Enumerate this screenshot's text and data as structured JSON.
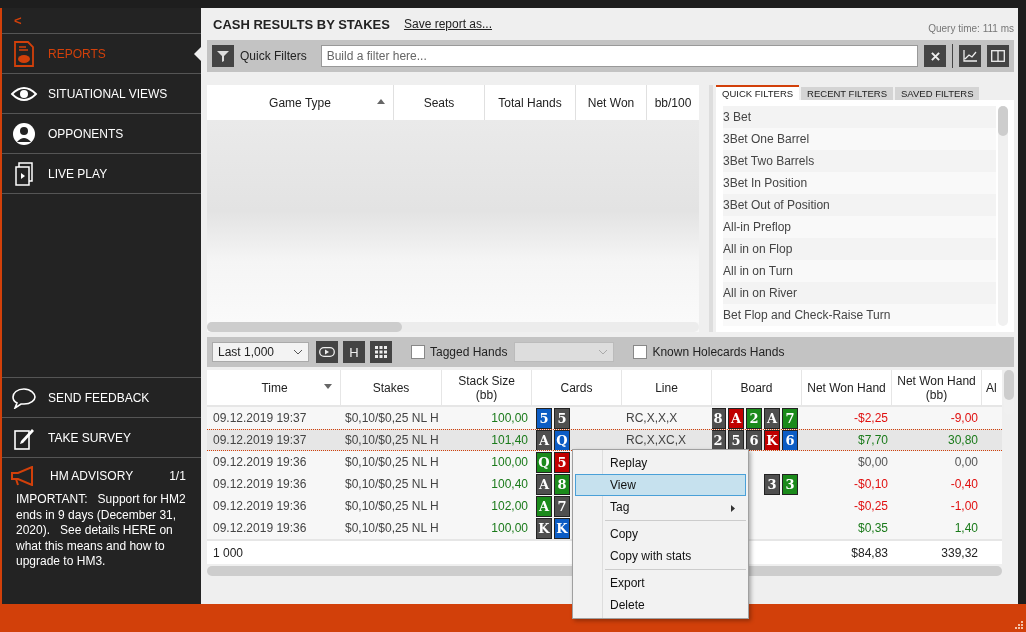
{
  "sidebar": {
    "collapse": "<",
    "items": [
      {
        "label": "REPORTS",
        "selected": true
      },
      {
        "label": "SITUATIONAL VIEWS",
        "selected": false
      },
      {
        "label": "OPPONENTS",
        "selected": false
      },
      {
        "label": "LIVE PLAY",
        "selected": false
      }
    ],
    "bottom_items": [
      {
        "label": "SEND FEEDBACK"
      },
      {
        "label": "TAKE SURVEY"
      }
    ],
    "advisory": {
      "title": "HM ADVISORY",
      "count": "1/1",
      "text": "IMPORTANT:   Support for HM2 ends in 9 days (December 31, 2020).   See details HERE on what this means and how to upgrade to HM3."
    }
  },
  "report": {
    "title": "CASH RESULTS BY STAKES",
    "save_link": "Save report as...",
    "query_time": "Query time: 111 ms",
    "filter_label": "Quick Filters",
    "filter_placeholder": "Build a filter here...",
    "summary_columns": [
      "Game Type",
      "Seats",
      "Total Hands",
      "Net Won",
      "bb/100"
    ]
  },
  "filter_panel": {
    "tabs": [
      {
        "label": "QUICK FILTERS",
        "selected": true
      },
      {
        "label": "RECENT FILTERS",
        "selected": false
      },
      {
        "label": "SAVED FILTERS",
        "selected": false
      }
    ],
    "items": [
      "3 Bet",
      "3Bet One Barrel",
      "3Bet Two Barrels",
      "3Bet In Position",
      "3Bet Out of Position",
      "All-in Preflop",
      "All in on Flop",
      "All in on Turn",
      "All in on River",
      "Bet Flop and Check-Raise Turn"
    ]
  },
  "hands_toolbar": {
    "range": "Last 1,000",
    "h_button": "H",
    "tagged": {
      "label": "Tagged Hands",
      "checked": false
    },
    "known": {
      "label": "Known Holecards Hands",
      "checked": false
    }
  },
  "hands_table": {
    "columns": [
      "Time",
      "Stakes",
      "Stack Size (bb)",
      "Cards",
      "Line",
      "Board",
      "Net Won Hand",
      "Net Won Hand (bb)",
      "Al"
    ],
    "rows": [
      {
        "time": "09.12.2019 19:37",
        "stakes": "$0,10/$0,25 NL H",
        "stack": "100,00",
        "cards": [
          {
            "rank": "5",
            "color": "#0b5cc4"
          },
          {
            "rank": "5",
            "color": "#4f4f4f"
          }
        ],
        "line": "RC,X,X,X",
        "board": [
          {
            "rank": "8",
            "color": "#4f4f4f"
          },
          {
            "rank": "A",
            "color": "#c00000"
          },
          {
            "rank": "2",
            "color": "#1b8a1b"
          },
          {
            "rank": "A",
            "color": "#4f4f4f"
          },
          {
            "rank": "7",
            "color": "#1b8a1b"
          }
        ],
        "net_won": "-$2,25",
        "net_won_bb": "-9,00",
        "color": "#e01010",
        "selected": false
      },
      {
        "time": "09.12.2019 19:37",
        "stakes": "$0,10/$0,25 NL H",
        "stack": "101,40",
        "cards": [
          {
            "rank": "A",
            "color": "#4f4f4f"
          },
          {
            "rank": "Q",
            "color": "#0b5cc4"
          }
        ],
        "line": "RC,X,XC,X",
        "board": [
          {
            "rank": "2",
            "color": "#4f4f4f"
          },
          {
            "rank": "5",
            "color": "#4f4f4f"
          },
          {
            "rank": "6",
            "color": "#4f4f4f"
          },
          {
            "rank": "K",
            "color": "#c00000"
          },
          {
            "rank": "6",
            "color": "#0b5cc4"
          }
        ],
        "net_won": "$7,70",
        "net_won_bb": "30,80",
        "color": "#1a7a1a",
        "selected": true
      },
      {
        "time": "09.12.2019 19:36",
        "stakes": "$0,10/$0,25 NL H",
        "stack": "100,00",
        "cards": [
          {
            "rank": "Q",
            "color": "#1b8a1b"
          },
          {
            "rank": "5",
            "color": "#c00000"
          }
        ],
        "board": [],
        "net_won": "$0,00",
        "net_won_bb": "0,00",
        "color": "#555555",
        "selected": false
      },
      {
        "time": "09.12.2019 19:36",
        "stakes": "$0,10/$0,25 NL H",
        "stack": "100,40",
        "cards": [
          {
            "rank": "A",
            "color": "#4f4f4f"
          },
          {
            "rank": "8",
            "color": "#1b8a1b"
          }
        ],
        "board": [
          {
            "rank": "3",
            "color": "#4f4f4f"
          },
          {
            "rank": "3",
            "color": "#1b8a1b"
          }
        ],
        "net_won": "-$0,10",
        "net_won_bb": "-0,40",
        "color": "#e01010",
        "selected": false
      },
      {
        "time": "09.12.2019 19:36",
        "stakes": "$0,10/$0,25 NL H",
        "stack": "102,00",
        "cards": [
          {
            "rank": "A",
            "color": "#1b8a1b"
          },
          {
            "rank": "7",
            "color": "#4f4f4f"
          }
        ],
        "board": [],
        "net_won": "-$0,25",
        "net_won_bb": "-1,00",
        "color": "#e01010",
        "selected": false
      },
      {
        "time": "09.12.2019 19:36",
        "stakes": "$0,10/$0,25 NL H",
        "stack": "100,00",
        "cards": [
          {
            "rank": "K",
            "color": "#4f4f4f"
          },
          {
            "rank": "K",
            "color": "#0b5cc4"
          }
        ],
        "board": [],
        "net_won": "$0,35",
        "net_won_bb": "1,40",
        "color": "#1a7a1a",
        "selected": false
      }
    ],
    "totals": {
      "count": "1 000",
      "net_won": "$84,83",
      "net_won_bb": "339,32"
    }
  },
  "context_menu": {
    "groups": [
      [
        {
          "label": "Replay",
          "selected": false,
          "submenu": false
        },
        {
          "label": "View",
          "selected": true,
          "submenu": false
        },
        {
          "label": "Tag",
          "selected": false,
          "submenu": true
        }
      ],
      [
        {
          "label": "Copy",
          "selected": false,
          "submenu": false
        },
        {
          "label": "Copy with stats",
          "selected": false,
          "submenu": false
        }
      ],
      [
        {
          "label": "Export",
          "selected": false,
          "submenu": false
        },
        {
          "label": "Delete",
          "selected": false,
          "submenu": false
        }
      ]
    ]
  }
}
